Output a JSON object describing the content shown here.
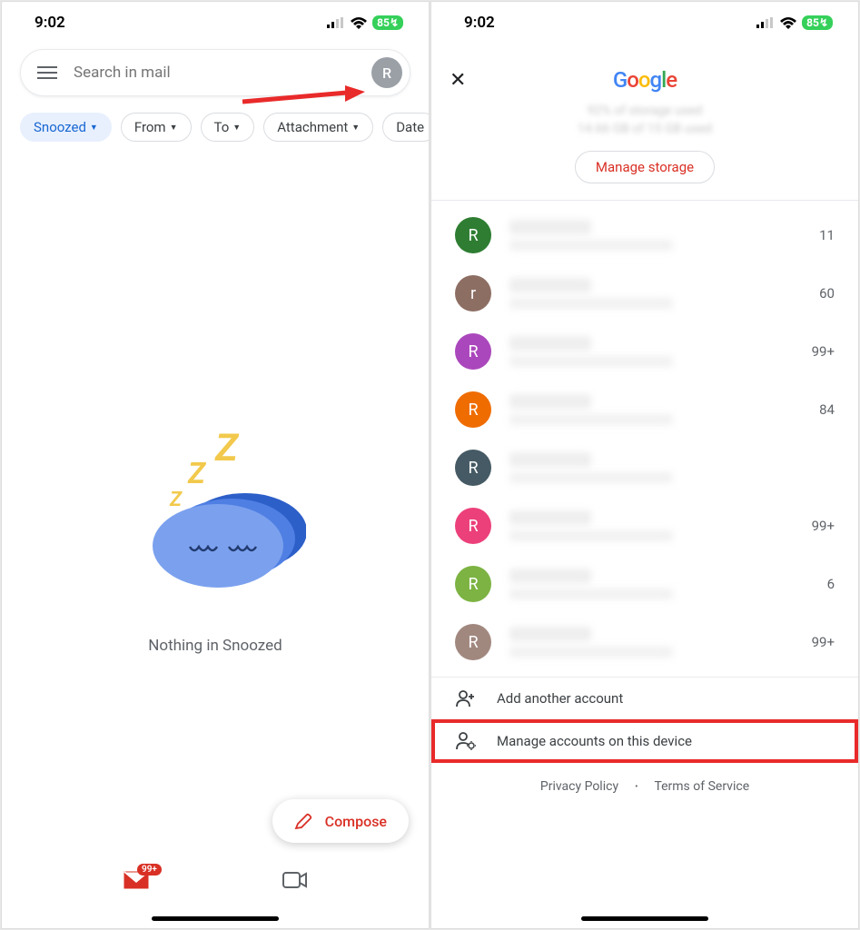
{
  "status": {
    "time": "9:02",
    "battery": "85"
  },
  "left": {
    "search_placeholder": "Search in mail",
    "avatar_letter": "R",
    "chips": [
      "Snoozed",
      "From",
      "To",
      "Attachment",
      "Date"
    ],
    "empty_text": "Nothing in Snoozed",
    "compose_label": "Compose",
    "mail_badge": "99+"
  },
  "right": {
    "logo": "Google",
    "storage_percent": "92% of storage used",
    "storage_used": "14.66 GB of 15 GB used",
    "manage_storage": "Manage storage",
    "accounts": [
      {
        "letter": "R",
        "bg": "#2e7d32",
        "count": "11"
      },
      {
        "letter": "r",
        "bg": "#8d6e63",
        "count": "60"
      },
      {
        "letter": "R",
        "bg": "#ab47bc",
        "count": "99+"
      },
      {
        "letter": "R",
        "bg": "#ef6c00",
        "count": "84"
      },
      {
        "letter": "R",
        "bg": "#455a64",
        "count": ""
      },
      {
        "letter": "R",
        "bg": "#ec407a",
        "count": "99+"
      },
      {
        "letter": "R",
        "bg": "#7cb342",
        "count": "6"
      },
      {
        "letter": "R",
        "bg": "#a1887f",
        "count": "99+"
      }
    ],
    "add_account": "Add another account",
    "manage_accounts": "Manage accounts on this device",
    "privacy": "Privacy Policy",
    "terms": "Terms of Service"
  }
}
